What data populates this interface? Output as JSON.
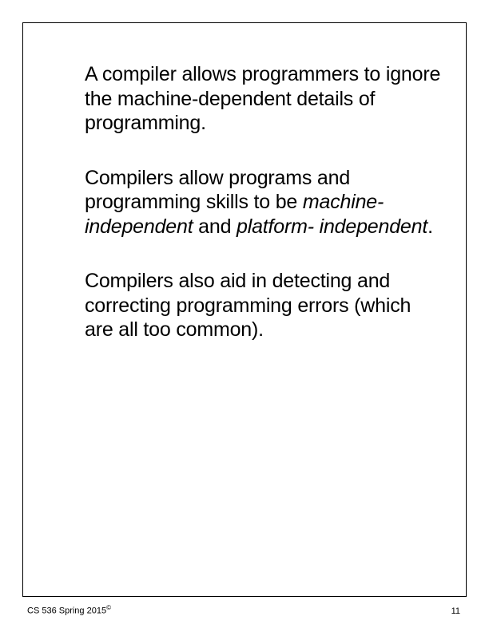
{
  "content": {
    "para1": "A compiler allows programmers to ignore the machine-dependent details of programming.",
    "para2_part1": "Compilers allow programs and programming skills to be ",
    "para2_italic1": "machine- independent",
    "para2_part2": " and ",
    "para2_italic2": "platform- independent",
    "para2_part3": ".",
    "para3": "Compilers also aid in detecting and correcting programming errors (which are all too common)."
  },
  "footer": {
    "left": "CS 536  Spring 2015",
    "copyright": "©",
    "right": "11"
  }
}
